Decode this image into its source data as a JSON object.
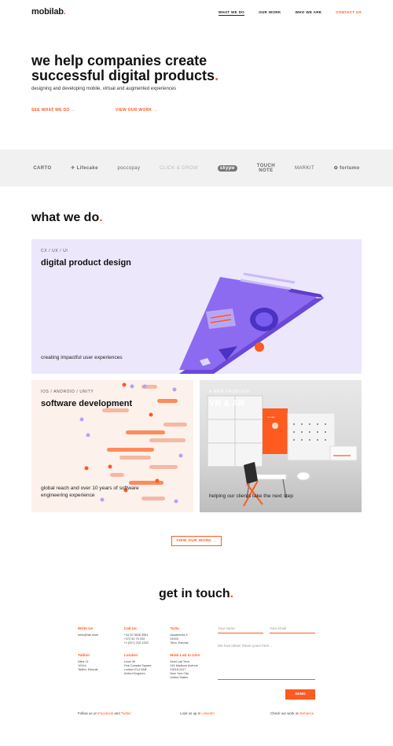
{
  "header": {
    "logo": "mobilab",
    "nav": [
      {
        "label": "WHAT WE DO",
        "active": true
      },
      {
        "label": "OUR WORK"
      },
      {
        "label": "WHO WE ARE"
      },
      {
        "label": "CONTACT US",
        "cta": true
      }
    ]
  },
  "hero": {
    "title_line1": "we help companies create",
    "title_line2": "successful digital products",
    "subtitle": "designing and developing mobile, virtual and augmented experiences",
    "link_what": "SEE WHAT WE DO →",
    "link_work": "VIEW OUR WORK →"
  },
  "clients": [
    "CARTO",
    "Lifecake",
    "poccopay",
    "CLICK & GROW",
    "skype",
    "TOUCH NOTE",
    "MARKIT",
    "fortumo"
  ],
  "what_we_do": {
    "title": "what we do",
    "cards": [
      {
        "eyebrow": "CX / UX / UI",
        "title": "digital product design",
        "desc": "creating impactful user experiences"
      },
      {
        "eyebrow": "IOS / ANDROID / UNITY",
        "title": "software development",
        "desc_line1": "global reach and over 10 years of software",
        "desc_line2": "engineering experience"
      },
      {
        "eyebrow": "A NEW FRONTIER",
        "title": "VR & AR",
        "desc": "helping our clients take the next step"
      }
    ],
    "view_work_button": "VIEW OUR WORK →"
  },
  "contact": {
    "title": "get in touch",
    "columns": [
      {
        "heading": "Write Us",
        "lines": [
          "hello@lab.mobi"
        ]
      },
      {
        "heading": "Call Us",
        "lines": [
          "+44 20 3608 3981",
          "+372 52 75 033",
          "+1 (917) 310 1322"
        ]
      },
      {
        "heading": "Tartu",
        "lines": [
          "Akadeemia 3",
          "51003",
          "Tartu, Estonia"
        ]
      },
      {
        "heading": "Tallinn",
        "lines": [
          "Niine 11",
          "10414",
          "Tallinn, Estonia"
        ]
      },
      {
        "heading": "London",
        "lines": [
          "Level 39",
          "One Canada Square",
          "London E14 5AB",
          "United Kingdom"
        ]
      },
      {
        "heading": "Mobi Lab in USA",
        "lines": [
          "Mobi Lab Tech",
          "244 Madison Avenue",
          "23016-2417",
          "New York City",
          "United States"
        ]
      }
    ],
    "form": {
      "name_placeholder": "Your name",
      "email_placeholder": "Your email",
      "message_placeholder": "We love ideas! Share yours here...",
      "send_label": "SEND"
    },
    "footer": {
      "follow_prefix": "Follow us on ",
      "facebook": "Facebook",
      "and": " and ",
      "twitter": "Twitter",
      "lookup_prefix": "Look us up in ",
      "linkedin": "LinkedIn",
      "check_prefix": "Check our work on ",
      "behance": "Behance"
    }
  },
  "colors": {
    "accent": "#ff5a1f",
    "purple": "#8c6bf0",
    "lavender": "#ece7fb"
  }
}
